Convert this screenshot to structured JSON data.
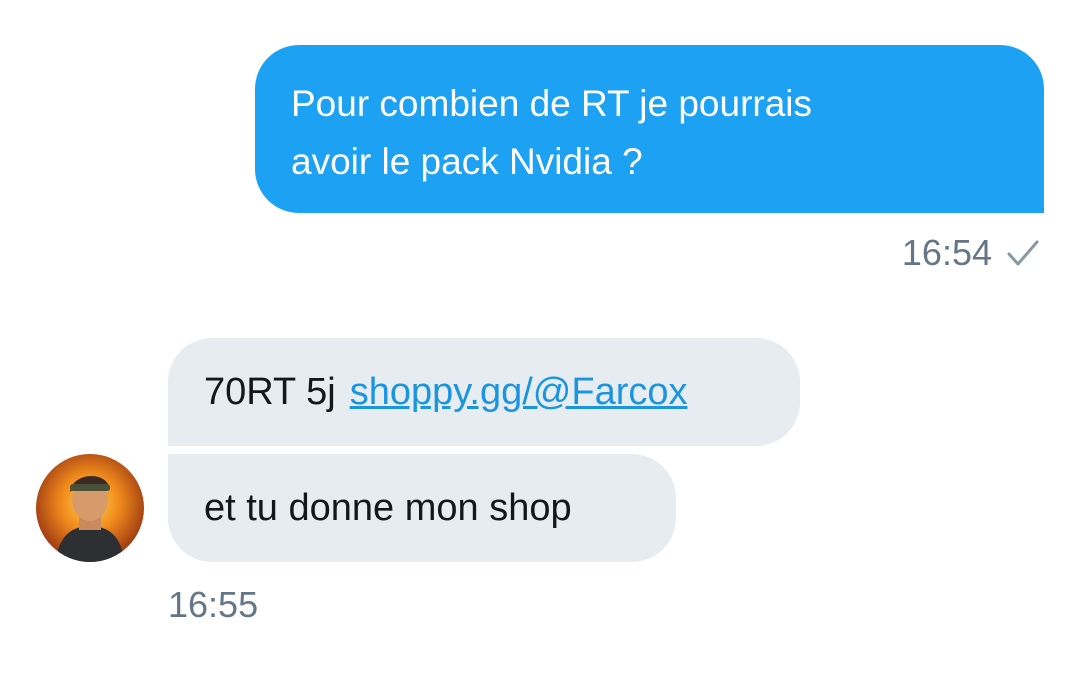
{
  "messages": {
    "outgoing": {
      "line1": "Pour combien de RT je pourrais",
      "line2": "avoir le pack Nvidia ?",
      "time": "16:54",
      "status_icon": "check-icon"
    },
    "incoming": {
      "first_text": "70RT 5j",
      "first_link": "shoppy.gg/@Farcox",
      "second_text": "et tu donne mon shop",
      "time": "16:55",
      "avatar": "avatar-icon"
    }
  },
  "colors": {
    "outgoing_bubble": "#1da1f2",
    "incoming_bubble": "#e6ecf0",
    "link": "#1b95e0",
    "timestamp": "#657786"
  }
}
